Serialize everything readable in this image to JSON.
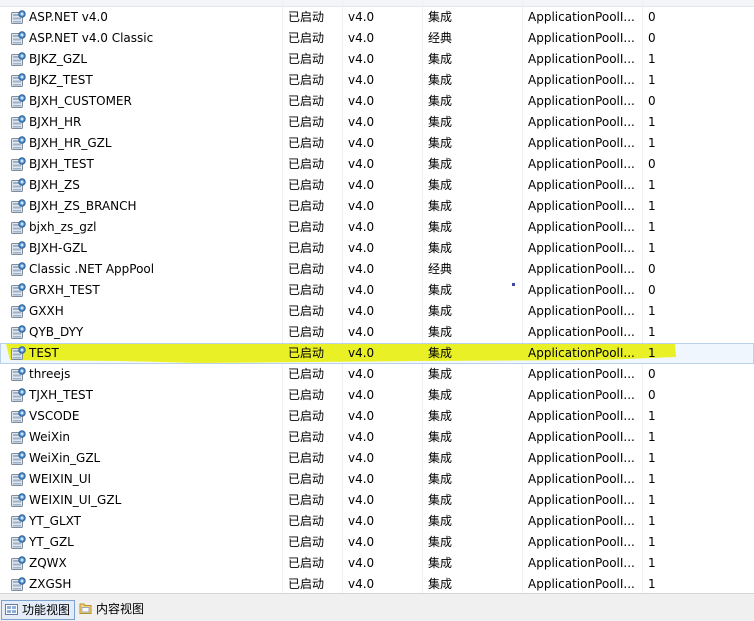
{
  "app_pools": {
    "rows": [
      {
        "name": "ASP.NET v4.0",
        "status": "已启动",
        "version": "v4.0",
        "mode": "集成",
        "identity": "ApplicationPoolI...",
        "apps": "0"
      },
      {
        "name": "ASP.NET v4.0 Classic",
        "status": "已启动",
        "version": "v4.0",
        "mode": "经典",
        "identity": "ApplicationPoolI...",
        "apps": "0"
      },
      {
        "name": "BJKZ_GZL",
        "status": "已启动",
        "version": "v4.0",
        "mode": "集成",
        "identity": "ApplicationPoolI...",
        "apps": "1"
      },
      {
        "name": "BJKZ_TEST",
        "status": "已启动",
        "version": "v4.0",
        "mode": "集成",
        "identity": "ApplicationPoolI...",
        "apps": "1"
      },
      {
        "name": "BJXH_CUSTOMER",
        "status": "已启动",
        "version": "v4.0",
        "mode": "集成",
        "identity": "ApplicationPoolI...",
        "apps": "0"
      },
      {
        "name": "BJXH_HR",
        "status": "已启动",
        "version": "v4.0",
        "mode": "集成",
        "identity": "ApplicationPoolI...",
        "apps": "1"
      },
      {
        "name": "BJXH_HR_GZL",
        "status": "已启动",
        "version": "v4.0",
        "mode": "集成",
        "identity": "ApplicationPoolI...",
        "apps": "1"
      },
      {
        "name": "BJXH_TEST",
        "status": "已启动",
        "version": "v4.0",
        "mode": "集成",
        "identity": "ApplicationPoolI...",
        "apps": "0"
      },
      {
        "name": "BJXH_ZS",
        "status": "已启动",
        "version": "v4.0",
        "mode": "集成",
        "identity": "ApplicationPoolI...",
        "apps": "1"
      },
      {
        "name": "BJXH_ZS_BRANCH",
        "status": "已启动",
        "version": "v4.0",
        "mode": "集成",
        "identity": "ApplicationPoolI...",
        "apps": "1"
      },
      {
        "name": "bjxh_zs_gzl",
        "status": "已启动",
        "version": "v4.0",
        "mode": "集成",
        "identity": "ApplicationPoolI...",
        "apps": "1"
      },
      {
        "name": "BJXH-GZL",
        "status": "已启动",
        "version": "v4.0",
        "mode": "集成",
        "identity": "ApplicationPoolI...",
        "apps": "1"
      },
      {
        "name": "Classic .NET AppPool",
        "status": "已启动",
        "version": "v4.0",
        "mode": "经典",
        "identity": "ApplicationPoolI...",
        "apps": "0"
      },
      {
        "name": "GRXH_TEST",
        "status": "已启动",
        "version": "v4.0",
        "mode": "集成",
        "identity": "ApplicationPoolI...",
        "apps": "0"
      },
      {
        "name": "GXXH",
        "status": "已启动",
        "version": "v4.0",
        "mode": "集成",
        "identity": "ApplicationPoolI...",
        "apps": "1"
      },
      {
        "name": "QYB_DYY",
        "status": "已启动",
        "version": "v4.0",
        "mode": "集成",
        "identity": "ApplicationPoolI...",
        "apps": "1"
      },
      {
        "name": "TEST",
        "status": "已启动",
        "version": "v4.0",
        "mode": "集成",
        "identity": "ApplicationPoolI...",
        "apps": "1"
      },
      {
        "name": "threejs",
        "status": "已启动",
        "version": "v4.0",
        "mode": "集成",
        "identity": "ApplicationPoolI...",
        "apps": "0"
      },
      {
        "name": "TJXH_TEST",
        "status": "已启动",
        "version": "v4.0",
        "mode": "集成",
        "identity": "ApplicationPoolI...",
        "apps": "0"
      },
      {
        "name": "VSCODE",
        "status": "已启动",
        "version": "v4.0",
        "mode": "集成",
        "identity": "ApplicationPoolI...",
        "apps": "1"
      },
      {
        "name": "WeiXin",
        "status": "已启动",
        "version": "v4.0",
        "mode": "集成",
        "identity": "ApplicationPoolI...",
        "apps": "1"
      },
      {
        "name": "WeiXin_GZL",
        "status": "已启动",
        "version": "v4.0",
        "mode": "集成",
        "identity": "ApplicationPoolI...",
        "apps": "1"
      },
      {
        "name": "WEIXIN_UI",
        "status": "已启动",
        "version": "v4.0",
        "mode": "集成",
        "identity": "ApplicationPoolI...",
        "apps": "1"
      },
      {
        "name": "WEIXIN_UI_GZL",
        "status": "已启动",
        "version": "v4.0",
        "mode": "集成",
        "identity": "ApplicationPoolI...",
        "apps": "1"
      },
      {
        "name": "YT_GLXT",
        "status": "已启动",
        "version": "v4.0",
        "mode": "集成",
        "identity": "ApplicationPoolI...",
        "apps": "1"
      },
      {
        "name": "YT_GZL",
        "status": "已启动",
        "version": "v4.0",
        "mode": "集成",
        "identity": "ApplicationPoolI...",
        "apps": "1"
      },
      {
        "name": "ZQWX",
        "status": "已启动",
        "version": "v4.0",
        "mode": "集成",
        "identity": "ApplicationPoolI...",
        "apps": "1"
      },
      {
        "name": "ZXGSH",
        "status": "已启动",
        "version": "v4.0",
        "mode": "集成",
        "identity": "ApplicationPoolI...",
        "apps": "1"
      }
    ],
    "selected_index": 16,
    "row_icon": "app-pool-icon",
    "highlight_color": "#e8f000"
  },
  "statusbar": {
    "tabs": [
      {
        "label": "功能视图",
        "icon": "features-view-icon",
        "active": true
      },
      {
        "label": "内容视图",
        "icon": "content-view-icon",
        "active": false
      }
    ]
  }
}
